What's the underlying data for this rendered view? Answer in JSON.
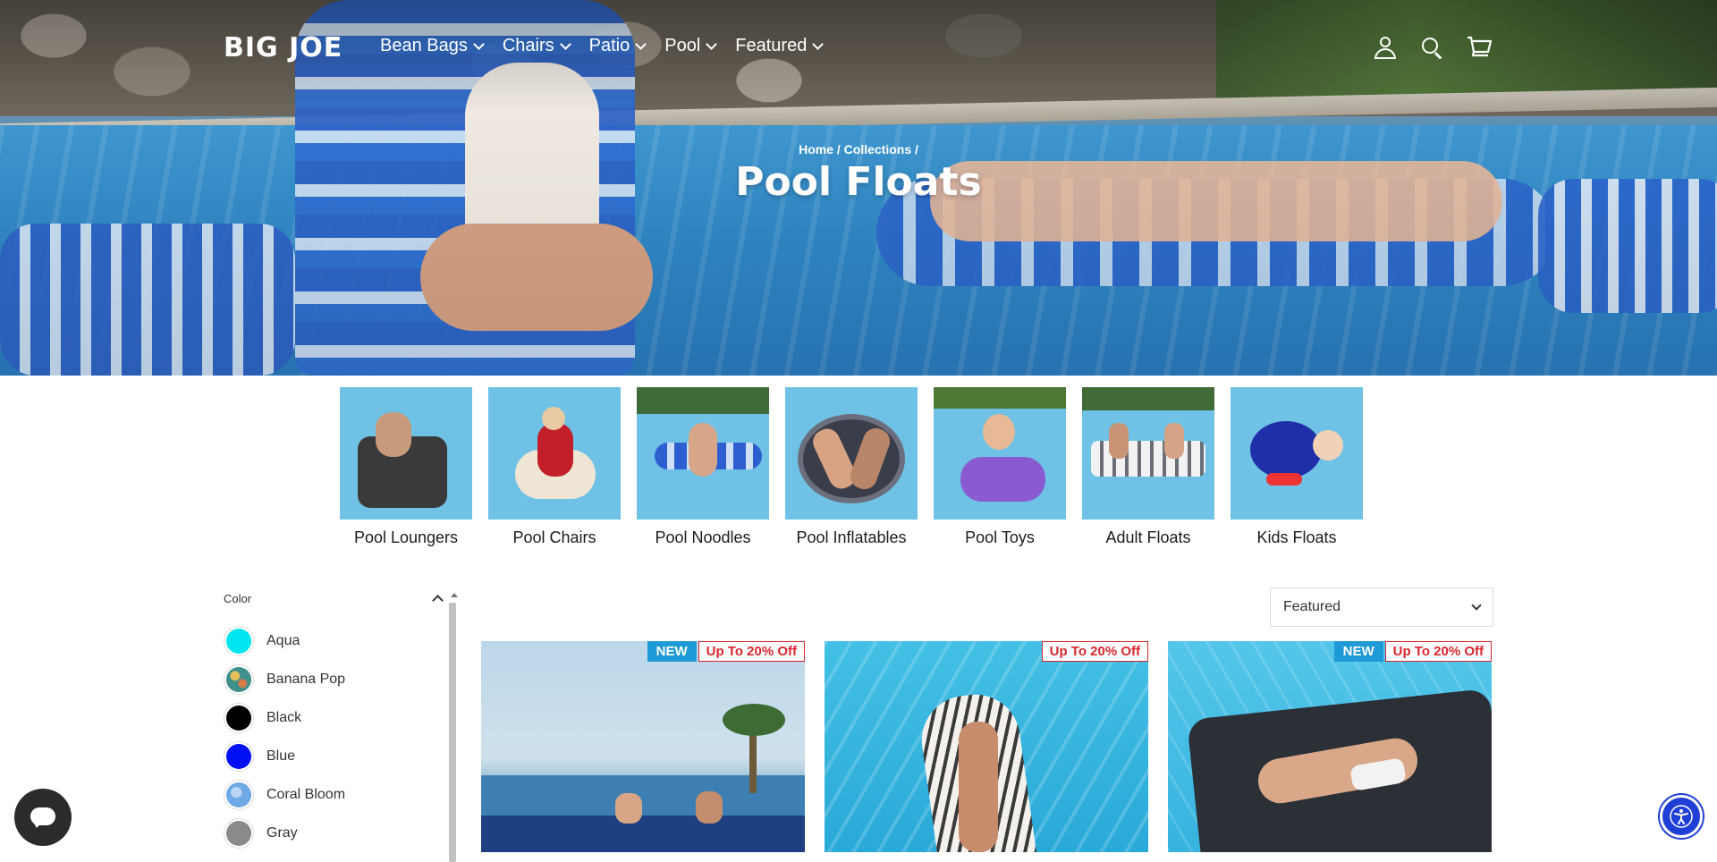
{
  "header": {
    "logo": "BIG JOE",
    "nav": [
      {
        "label": "Bean Bags"
      },
      {
        "label": "Chairs"
      },
      {
        "label": "Patio"
      },
      {
        "label": "Pool"
      },
      {
        "label": "Featured"
      }
    ],
    "icons": [
      "account-icon",
      "search-icon",
      "cart-icon"
    ]
  },
  "breadcrumb": {
    "home": "Home",
    "sep": "/",
    "collections": "Collections"
  },
  "page": {
    "title": "Pool Floats"
  },
  "categories": [
    {
      "label": "Pool Loungers"
    },
    {
      "label": "Pool Chairs"
    },
    {
      "label": "Pool Noodles"
    },
    {
      "label": "Pool Inflatables"
    },
    {
      "label": "Pool Toys"
    },
    {
      "label": "Adult Floats"
    },
    {
      "label": "Kids Floats"
    }
  ],
  "filter": {
    "heading": "Color",
    "options": [
      {
        "label": "Aqua",
        "color": "#00e5f0"
      },
      {
        "label": "Banana Pop",
        "color": "#3f8f8a"
      },
      {
        "label": "Black",
        "color": "#000000"
      },
      {
        "label": "Blue",
        "color": "#0010f5"
      },
      {
        "label": "Coral Bloom",
        "color": "#6ea8e6"
      },
      {
        "label": "Gray",
        "color": "#8a8a8a"
      }
    ]
  },
  "sort": {
    "selected": "Featured"
  },
  "products": [
    {
      "badge_new": "NEW",
      "badge_sale": "Up To 20% Off"
    },
    {
      "badge_new": "",
      "badge_sale": "Up To 20% Off"
    },
    {
      "badge_new": "NEW",
      "badge_sale": "Up To 20% Off"
    }
  ],
  "colors": {
    "accent_blue": "#1e9ad6",
    "sale_red": "#d8262e",
    "a11y_blue": "#1f3fd6"
  }
}
